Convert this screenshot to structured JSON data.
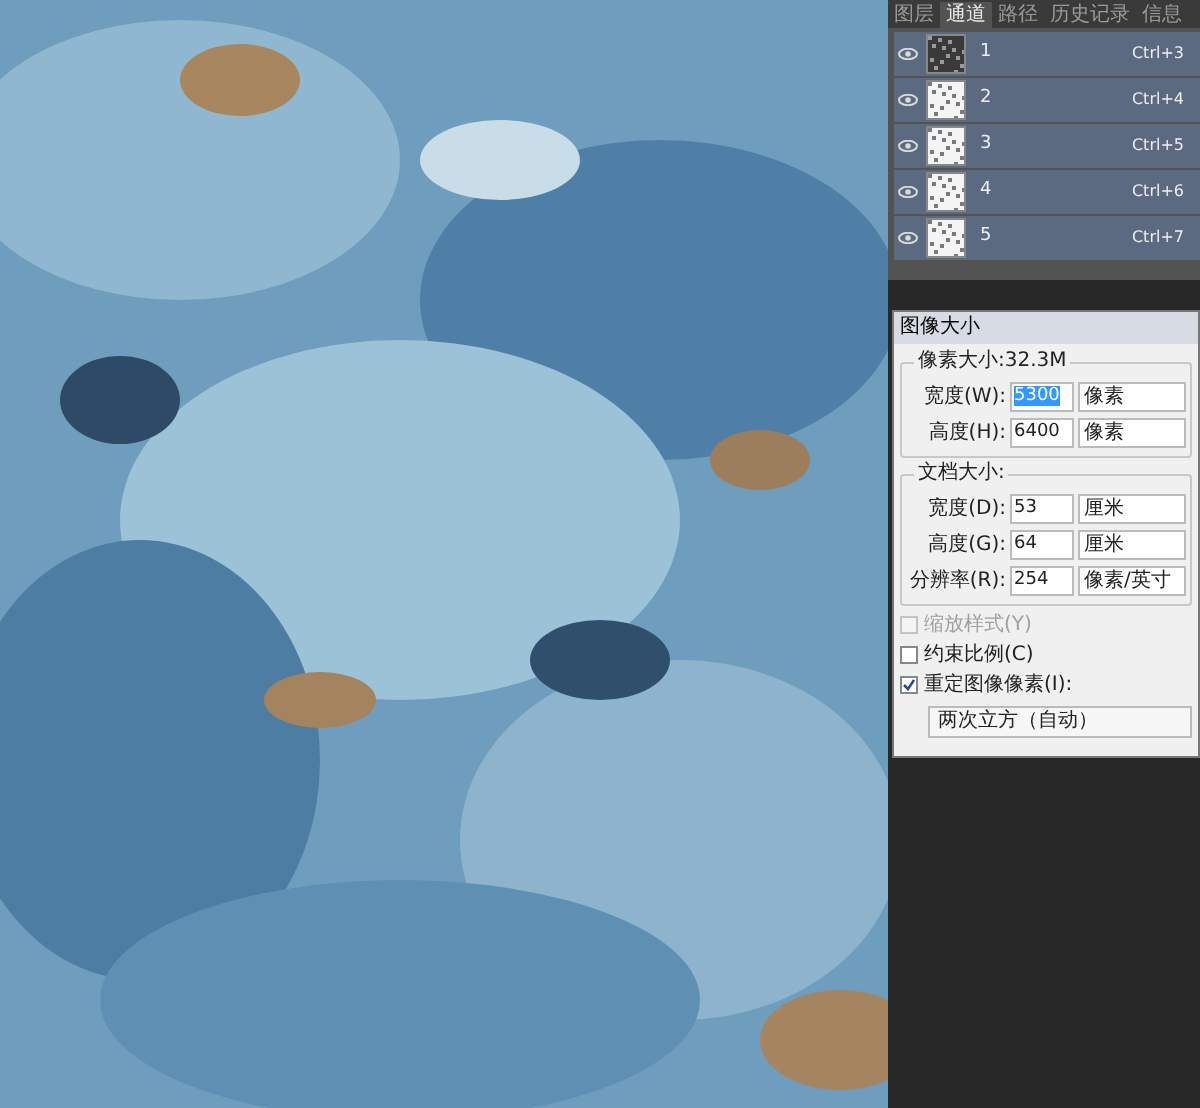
{
  "panel": {
    "tabs": [
      {
        "label": "图层",
        "selected": false
      },
      {
        "label": "通道",
        "selected": true
      },
      {
        "label": "路径",
        "selected": false
      },
      {
        "label": "历史记录",
        "selected": false
      },
      {
        "label": "信息",
        "selected": false
      }
    ],
    "channels": [
      {
        "name": "1",
        "shortcut": "Ctrl+3",
        "visible": true
      },
      {
        "name": "2",
        "shortcut": "Ctrl+4",
        "visible": true
      },
      {
        "name": "3",
        "shortcut": "Ctrl+5",
        "visible": true
      },
      {
        "name": "4",
        "shortcut": "Ctrl+6",
        "visible": true
      },
      {
        "name": "5",
        "shortcut": "Ctrl+7",
        "visible": true
      }
    ]
  },
  "dialog": {
    "title": "图像大小",
    "groups": [
      {
        "title": "像素大小:32.3M",
        "fields": [
          {
            "label": "宽度(W):",
            "value": "5300",
            "unit": "像素",
            "selected": true
          },
          {
            "label": "高度(H):",
            "value": "6400",
            "unit": "像素",
            "selected": false
          }
        ]
      },
      {
        "title": "文档大小:",
        "fields": [
          {
            "label": "宽度(D):",
            "value": "53",
            "unit": "厘米",
            "selected": false
          },
          {
            "label": "高度(G):",
            "value": "64",
            "unit": "厘米",
            "selected": false
          },
          {
            "label": "分辨率(R):",
            "value": "254",
            "unit": "像素/英寸",
            "selected": false
          }
        ]
      }
    ],
    "options": [
      {
        "label": "缩放样式(Y)",
        "checked": false,
        "disabled": true
      },
      {
        "label": "约束比例(C)",
        "checked": false,
        "disabled": false
      },
      {
        "label": "重定图像像素(I):",
        "checked": true,
        "disabled": false
      }
    ],
    "resample": "两次立方（自动）"
  }
}
